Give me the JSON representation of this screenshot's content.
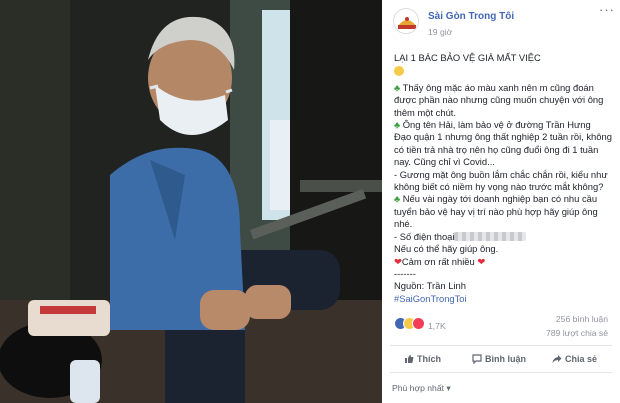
{
  "post": {
    "page_name": "Sài Gòn Trong Tôi",
    "time": "19 giờ",
    "more_icon": "···",
    "title": "LẠI 1 BÁC BẢO VỆ GIÀ MẤT VIỆC",
    "lines": {
      "l1a": "Thấy ông mặc áo màu xanh nên m cũng đoán",
      "l1b": "được phần nào nhưng cũng muốn chuyện với ông",
      "l1c": "thêm một chút.",
      "l2a": "Ông tên Hải, làm bảo vệ ở đường Trần Hưng",
      "l2b": "Đạo quận 1 nhưng ông thất nghiệp 2 tuần rồi, không",
      "l2c": "có tiền trả nhà trọ nên họ cũng đuổi ông đi 1 tuần",
      "l2d": "nay. Cũng chỉ vì Covid...",
      "l3a": "- Gương mặt ông buồn lắm chắc chắn rồi, kiểu như",
      "l3b": "không biết có niềm hy vọng nào trước mắt không?",
      "l4a": "Nếu vài ngày tới doanh nghiệp bạn có nhu cầu",
      "l4b": "tuyển bảo vệ hay vị trí nào phù hợp hãy giúp ông",
      "l4c": "nhé.",
      "l5a": "- Số điện thoại",
      "l5b": "Nếu có thể hãy giúp ông.",
      "l6": "Cảm ơn rất nhiều",
      "sep": "-------",
      "source": "Nguồn: Trần Linh",
      "hashtag": "#SaiGonTrongToi"
    }
  },
  "stats": {
    "reactions": "1,7K",
    "comments": "256 bình luận",
    "shares": "789 lượt chia sẻ"
  },
  "actions": {
    "like": "Thích",
    "comment": "Bình luận",
    "share": "Chia sẻ"
  },
  "sort": "Phù hợp nhất ▾",
  "colors": {
    "link": "#4267b2",
    "muted": "#90949c",
    "clover": "#3a9d3a",
    "heart": "#e02f3e"
  }
}
